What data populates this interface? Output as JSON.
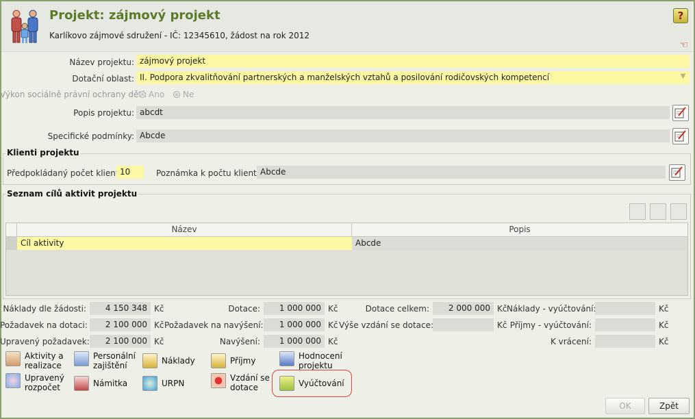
{
  "header": {
    "title": "Projekt: zájmový projekt",
    "subtitle": "Karlíkovo zájmové sdružení - IČ: 12345610, žádost na rok 2012",
    "help_glyph": "?"
  },
  "form": {
    "name_label": "Název projektu:",
    "name_value": "zájmový projekt",
    "area_label": "Dotační oblast:",
    "area_value": "II. Podpora zkvalitňování partnerských a manželských vztahů a posilování rodičovských kompetencí",
    "oversight_label": "Výkon sociálně právní ochrany dětí:",
    "radio_yes": "Ano",
    "radio_no": "Ne",
    "description_label": "Popis projektu:",
    "description_value": "abcdt",
    "conditions_label": "Specifické podmínky:",
    "conditions_value": "Abcde"
  },
  "clients": {
    "title": "Klienti projektu",
    "count_label": "Předpokládaný počet klientů:",
    "count_value": "10",
    "note_label": "Poznámka k počtu klientů:",
    "note_value": "Abcde"
  },
  "goals": {
    "title": "Seznam cílů aktivit projektu",
    "columns": [
      "Název",
      "Popis"
    ],
    "rows": [
      {
        "name": "Cíl aktivity",
        "description": "Abcde"
      }
    ]
  },
  "finance": {
    "currency": "Kč",
    "col1": [
      {
        "label": "Náklady dle žádosti:",
        "value": "4 150 348"
      },
      {
        "label": "Požadavek na dotaci:",
        "value": "2 100 000"
      },
      {
        "label": "Upravený požadavek:",
        "value": "2 100 000"
      }
    ],
    "col2": [
      {
        "label": "Dotace:",
        "value": "1 000 000"
      },
      {
        "label": "Požadavek na navýšení:",
        "value": "1 000 000"
      },
      {
        "label": "Navýšení:",
        "value": "1 000 000"
      }
    ],
    "col3": [
      {
        "label": "Dotace celkem:",
        "value": "2 000 000"
      },
      {
        "label": "Výše vzdání se dotace:",
        "value": ""
      }
    ],
    "col4": [
      {
        "label": "Náklady - vyúčtování:",
        "value": ""
      },
      {
        "label": "Příjmy - vyúčtování:",
        "value": ""
      },
      {
        "label": "K vrácení:",
        "value": ""
      }
    ]
  },
  "actions": {
    "activities": "Aktivity a realizace",
    "personnel": "Personální zajištění",
    "costs": "Náklady",
    "income": "Příjmy",
    "evaluation": "Hodnocení projektu",
    "adjusted_budget": "Upravený rozpočet",
    "objection": "Námitka",
    "urpn": "URPN",
    "waiver": "Vzdání se dotace",
    "settlement": "Vyúčtování"
  },
  "buttons": {
    "ok": "OK",
    "back": "Zpět"
  },
  "colors": {
    "title_green": "#5b7a2a",
    "field_yellow": "#fbf7a3",
    "field_gray": "#dcdcd6",
    "highlight_red": "#e04040"
  }
}
